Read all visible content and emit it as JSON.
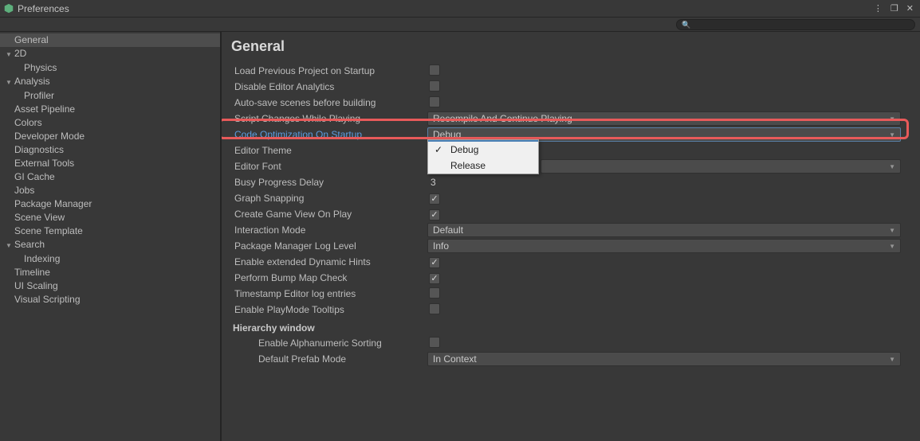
{
  "window": {
    "title": "Preferences"
  },
  "sidebar": {
    "items": [
      {
        "label": "General",
        "selected": true
      },
      {
        "label": "2D",
        "expandable": true
      },
      {
        "label": "Physics",
        "child": true
      },
      {
        "label": "Analysis",
        "expandable": true
      },
      {
        "label": "Profiler",
        "child": true
      },
      {
        "label": "Asset Pipeline"
      },
      {
        "label": "Colors"
      },
      {
        "label": "Developer Mode"
      },
      {
        "label": "Diagnostics"
      },
      {
        "label": "External Tools"
      },
      {
        "label": "GI Cache"
      },
      {
        "label": "Jobs"
      },
      {
        "label": "Package Manager"
      },
      {
        "label": "Scene View"
      },
      {
        "label": "Scene Template"
      },
      {
        "label": "Search",
        "expandable": true
      },
      {
        "label": "Indexing",
        "child": true
      },
      {
        "label": "Timeline"
      },
      {
        "label": "UI Scaling"
      },
      {
        "label": "Visual Scripting"
      }
    ]
  },
  "content": {
    "heading": "General",
    "rows": {
      "loadPrevious": "Load Previous Project on Startup",
      "disableAnalytics": "Disable Editor Analytics",
      "autoSave": "Auto-save scenes before building",
      "scriptChanges": "Script Changes While Playing",
      "scriptChangesVal": "Recompile And Continue Playing",
      "codeOpt": "Code Optimization On Startup",
      "codeOptVal": "Debug",
      "editorTheme": "Editor Theme",
      "editorFont": "Editor Font",
      "busyDelay": "Busy Progress Delay",
      "busyDelayVal": "3",
      "graphSnap": "Graph Snapping",
      "createGameView": "Create Game View On Play",
      "interactionMode": "Interaction Mode",
      "interactionModeVal": "Default",
      "pkgLogLevel": "Package Manager Log Level",
      "pkgLogLevelVal": "Info",
      "extHints": "Enable extended Dynamic Hints",
      "bumpMap": "Perform Bump Map Check",
      "timestamp": "Timestamp Editor log entries",
      "playModeTooltips": "Enable PlayMode Tooltips"
    },
    "hierarchy": {
      "header": "Hierarchy window",
      "alphaSort": "Enable Alphanumeric Sorting",
      "prefabMode": "Default Prefab Mode",
      "prefabModeVal": "In Context"
    },
    "popup": {
      "opt1": "Debug",
      "opt2": "Release"
    }
  }
}
